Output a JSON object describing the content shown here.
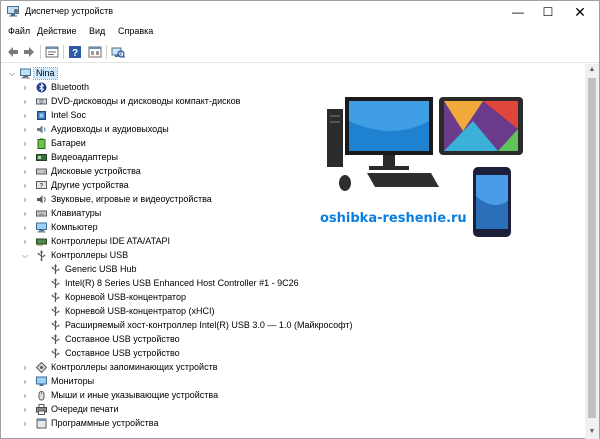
{
  "window": {
    "title": "Диспетчер устройств",
    "controls": {
      "minimize": "—",
      "maximize": "☐",
      "close": "✕"
    }
  },
  "menu": [
    "Файл",
    "Действие",
    "Вид",
    "Справка"
  ],
  "toolbar": {
    "icons": [
      "back-icon",
      "forward-icon",
      "properties-icon",
      "help-icon",
      "view-icon",
      "scan-hardware-icon"
    ]
  },
  "tree": {
    "root": "Nina",
    "items": [
      {
        "label": "Bluetooth",
        "icon": "bluetooth-icon",
        "expanded": false
      },
      {
        "label": "DVD-дисководы и дисководы компакт-дисков",
        "icon": "dvd-drive-icon",
        "expanded": false
      },
      {
        "label": "Intel Soc",
        "icon": "chip-icon",
        "expanded": false
      },
      {
        "label": "Аудиовходы и аудиовыходы",
        "icon": "speaker-icon",
        "expanded": false
      },
      {
        "label": "Батареи",
        "icon": "battery-icon",
        "expanded": false
      },
      {
        "label": "Видеоадаптеры",
        "icon": "display-adapter-icon",
        "expanded": false
      },
      {
        "label": "Дисковые устройства",
        "icon": "disk-drive-icon",
        "expanded": false
      },
      {
        "label": "Другие устройства",
        "icon": "unknown-device-icon",
        "expanded": false
      },
      {
        "label": "Звуковые, игровые и видеоустройства",
        "icon": "sound-device-icon",
        "expanded": false
      },
      {
        "label": "Клавиатуры",
        "icon": "keyboard-icon",
        "expanded": false
      },
      {
        "label": "Компьютер",
        "icon": "computer-icon",
        "expanded": false
      },
      {
        "label": "Контроллеры IDE ATA/ATAPI",
        "icon": "ide-controller-icon",
        "expanded": false
      },
      {
        "label": "Контроллеры USB",
        "icon": "usb-icon",
        "expanded": true
      },
      {
        "label": "Контроллеры запоминающих устройств",
        "icon": "storage-controller-icon",
        "expanded": false
      },
      {
        "label": "Мониторы",
        "icon": "monitor-icon",
        "expanded": false
      },
      {
        "label": "Мыши и иные указывающие устройства",
        "icon": "mouse-icon",
        "expanded": false
      },
      {
        "label": "Очереди печати",
        "icon": "printer-icon",
        "expanded": false
      },
      {
        "label": "Программные устройства",
        "icon": "software-device-icon",
        "expanded": false
      }
    ],
    "usb_children": [
      "Generic USB Hub",
      "Intel(R) 8 Series USB Enhanced Host Controller #1 - 9C26",
      "Корневой USB-концентратор",
      "Корневой USB-концентратор (xHCI)",
      "Расширяемый хост-контроллер Intel(R) USB 3.0 — 1.0 (Майкрософт)",
      "Составное USB устройство",
      "Составное USB устройство"
    ]
  },
  "watermark": "oshibka-reshenie.ru",
  "colors": {
    "selection": "#cce8ff",
    "watermark": "#0a7fe0",
    "usb_icon": "#555555"
  }
}
